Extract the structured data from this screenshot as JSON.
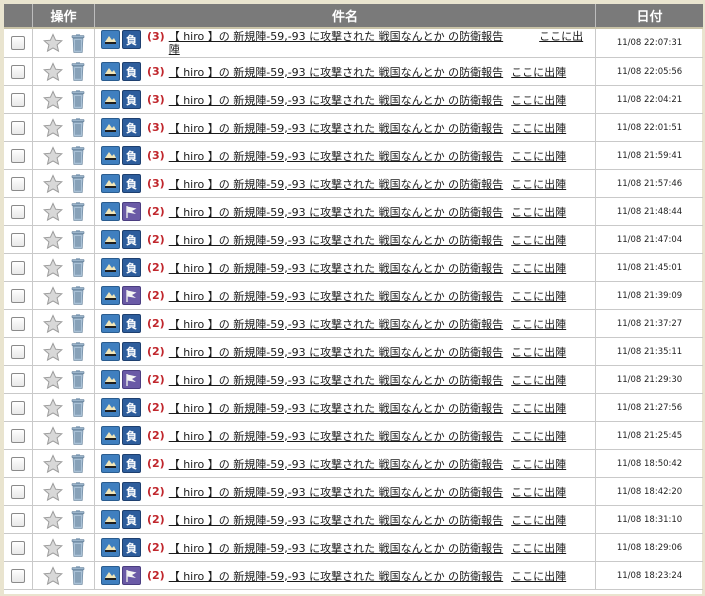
{
  "headers": {
    "ops": "操作",
    "subject": "件名",
    "date": "日付"
  },
  "link_text": "【 hiro 】の 新規陣-59,-93 に攻撃された 戦国なんとか の防衛報告",
  "first_row_wrap": {
    "part1": "【 hiro 】の 新規陣-59,-93 に攻撃された 戦国なんとか の防衛報告",
    "part2": "陣",
    "sortie": "ここに出"
  },
  "sortie_label": "ここに出陣",
  "rows": [
    {
      "count": "(3)",
      "badge": "defeat",
      "date": "11/08 22:07:31"
    },
    {
      "count": "(3)",
      "badge": "defeat",
      "date": "11/08 22:05:56"
    },
    {
      "count": "(3)",
      "badge": "defeat",
      "date": "11/08 22:04:21"
    },
    {
      "count": "(3)",
      "badge": "defeat",
      "date": "11/08 22:01:51"
    },
    {
      "count": "(3)",
      "badge": "defeat",
      "date": "11/08 21:59:41"
    },
    {
      "count": "(3)",
      "badge": "defeat",
      "date": "11/08 21:57:46"
    },
    {
      "count": "(2)",
      "badge": "flag",
      "date": "11/08 21:48:44"
    },
    {
      "count": "(2)",
      "badge": "defeat",
      "date": "11/08 21:47:04"
    },
    {
      "count": "(2)",
      "badge": "defeat",
      "date": "11/08 21:45:01"
    },
    {
      "count": "(2)",
      "badge": "flag",
      "date": "11/08 21:39:09"
    },
    {
      "count": "(2)",
      "badge": "defeat",
      "date": "11/08 21:37:27"
    },
    {
      "count": "(2)",
      "badge": "defeat",
      "date": "11/08 21:35:11"
    },
    {
      "count": "(2)",
      "badge": "flag",
      "date": "11/08 21:29:30"
    },
    {
      "count": "(2)",
      "badge": "defeat",
      "date": "11/08 21:27:56"
    },
    {
      "count": "(2)",
      "badge": "defeat",
      "date": "11/08 21:25:45"
    },
    {
      "count": "(2)",
      "badge": "defeat",
      "date": "11/08 18:50:42"
    },
    {
      "count": "(2)",
      "badge": "defeat",
      "date": "11/08 18:42:20"
    },
    {
      "count": "(2)",
      "badge": "defeat",
      "date": "11/08 18:31:10"
    },
    {
      "count": "(2)",
      "badge": "defeat",
      "date": "11/08 18:29:06"
    },
    {
      "count": "(2)",
      "badge": "flag",
      "date": "11/08 18:23:24"
    }
  ],
  "badge_text": {
    "defeat": "負"
  },
  "icons": {
    "report": "defense-report-icon",
    "defeat": "defeat-badge-icon",
    "flag": "flag-badge-icon",
    "star": "star-icon",
    "trash": "trash-icon"
  },
  "colors": {
    "header_bg": "#7a7a7a",
    "count_red": "#c0262c",
    "badge_navy": "#2d5d9c",
    "badge_purple": "#6a5aa6"
  }
}
